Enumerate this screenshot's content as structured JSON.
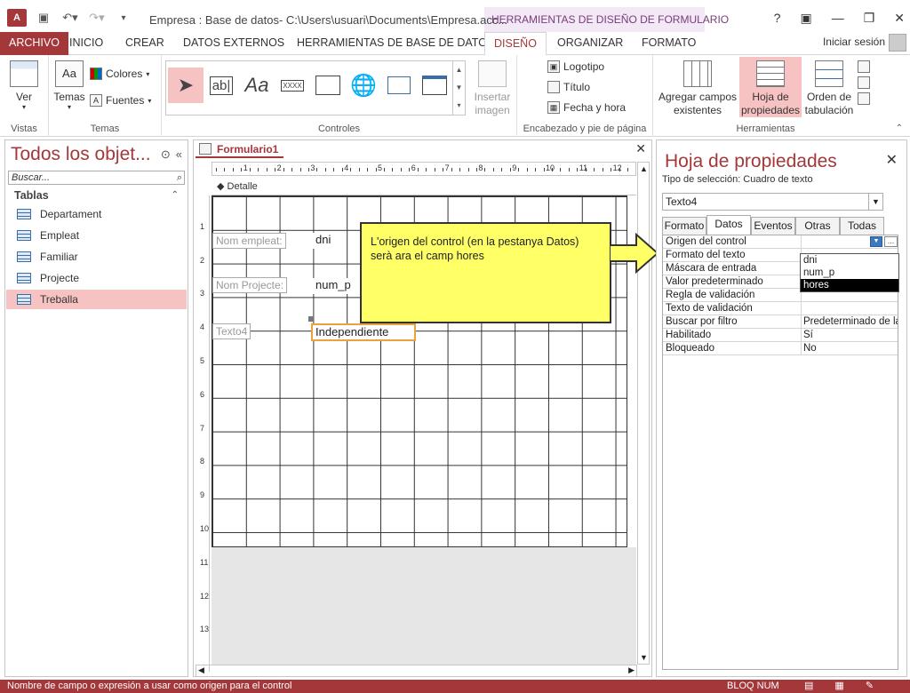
{
  "title_bar": {
    "doc_title": "Empresa : Base de datos- C:\\Users\\usuari\\Documents\\Empresa.acc...",
    "context_title": "HERRAMIENTAS DE DISEÑO DE FORMULARIO",
    "help": "?",
    "minimize": "—",
    "restore": "❐",
    "close": "✕"
  },
  "tabs": {
    "file": "ARCHIVO",
    "home": "INICIO",
    "create": "CREAR",
    "external": "DATOS EXTERNOS",
    "dbtools": "HERRAMIENTAS DE BASE DE DATOS",
    "design": "DISEÑO",
    "arrange": "ORGANIZAR",
    "format": "FORMATO",
    "signin": "Iniciar sesión"
  },
  "ribbon": {
    "views": {
      "label": "Vistas",
      "view_btn": "Ver"
    },
    "themes": {
      "label": "Temas",
      "themes_btn": "Temas",
      "colors_btn": "Colores",
      "fonts_btn": "Fuentes"
    },
    "controls": {
      "label": "Controles",
      "insert_image": "Insertar imagen"
    },
    "header_footer": {
      "label": "Encabezado y pie de página",
      "logo": "Logotipo",
      "title": "Título",
      "datetime": "Fecha y hora"
    },
    "tools": {
      "label": "Herramientas",
      "add_fields": "Agregar campos existentes",
      "property_sheet": "Hoja de propiedades",
      "tab_order": "Orden de tabulación"
    }
  },
  "nav": {
    "title": "Todos los objet...",
    "search_placeholder": "Buscar...",
    "section": "Tablas",
    "items": [
      "Departament",
      "Empleat",
      "Familiar",
      "Projecte",
      "Treballa"
    ]
  },
  "document": {
    "tab_label": "Formulario1",
    "section": "Detalle",
    "ruler_h": [
      "1",
      "2",
      "3",
      "4",
      "5",
      "6",
      "7",
      "8",
      "9",
      "10",
      "11",
      "12"
    ],
    "ruler_v": [
      "1",
      "2",
      "3",
      "4",
      "5",
      "6",
      "7",
      "8",
      "9",
      "10",
      "11",
      "12",
      "13"
    ],
    "controls": {
      "label1": "Nom empleat:",
      "text1": "dni",
      "label2": "Nom Projecte:",
      "text2": "num_p",
      "label3": "Texto4",
      "text3": "Independiente"
    }
  },
  "callout": {
    "text": "L'origen del control (en la pestanya Datos) serà ara el camp hores"
  },
  "property_sheet": {
    "title": "Hoja de propiedades",
    "selection_type": "Tipo de selección:  Cuadro de texto",
    "combo_value": "Texto4",
    "tabs": [
      "Formato",
      "Datos",
      "Eventos",
      "Otras",
      "Todas"
    ],
    "rows": [
      {
        "name": "Origen del control",
        "value": ""
      },
      {
        "name": "Formato del texto",
        "value": ""
      },
      {
        "name": "Máscara de entrada",
        "value": ""
      },
      {
        "name": "Valor predeterminado",
        "value": ""
      },
      {
        "name": "Regla de validación",
        "value": ""
      },
      {
        "name": "Texto de validación",
        "value": ""
      },
      {
        "name": "Buscar por filtro",
        "value": "Predeterminado de la"
      },
      {
        "name": "Habilitado",
        "value": "Sí"
      },
      {
        "name": "Bloqueado",
        "value": "No"
      }
    ],
    "dropdown_options": [
      "dni",
      "num_p",
      "hores"
    ],
    "dropdown_selected": "hores"
  },
  "status_bar": {
    "text": "Nombre de campo o expresión a usar como origen para el control",
    "mode": "BLOQ NUM"
  },
  "colors": {
    "accent": "#a4373a",
    "selection": "#f7c2c2",
    "callout": "#ffff66",
    "context": "#7a3b7a"
  }
}
